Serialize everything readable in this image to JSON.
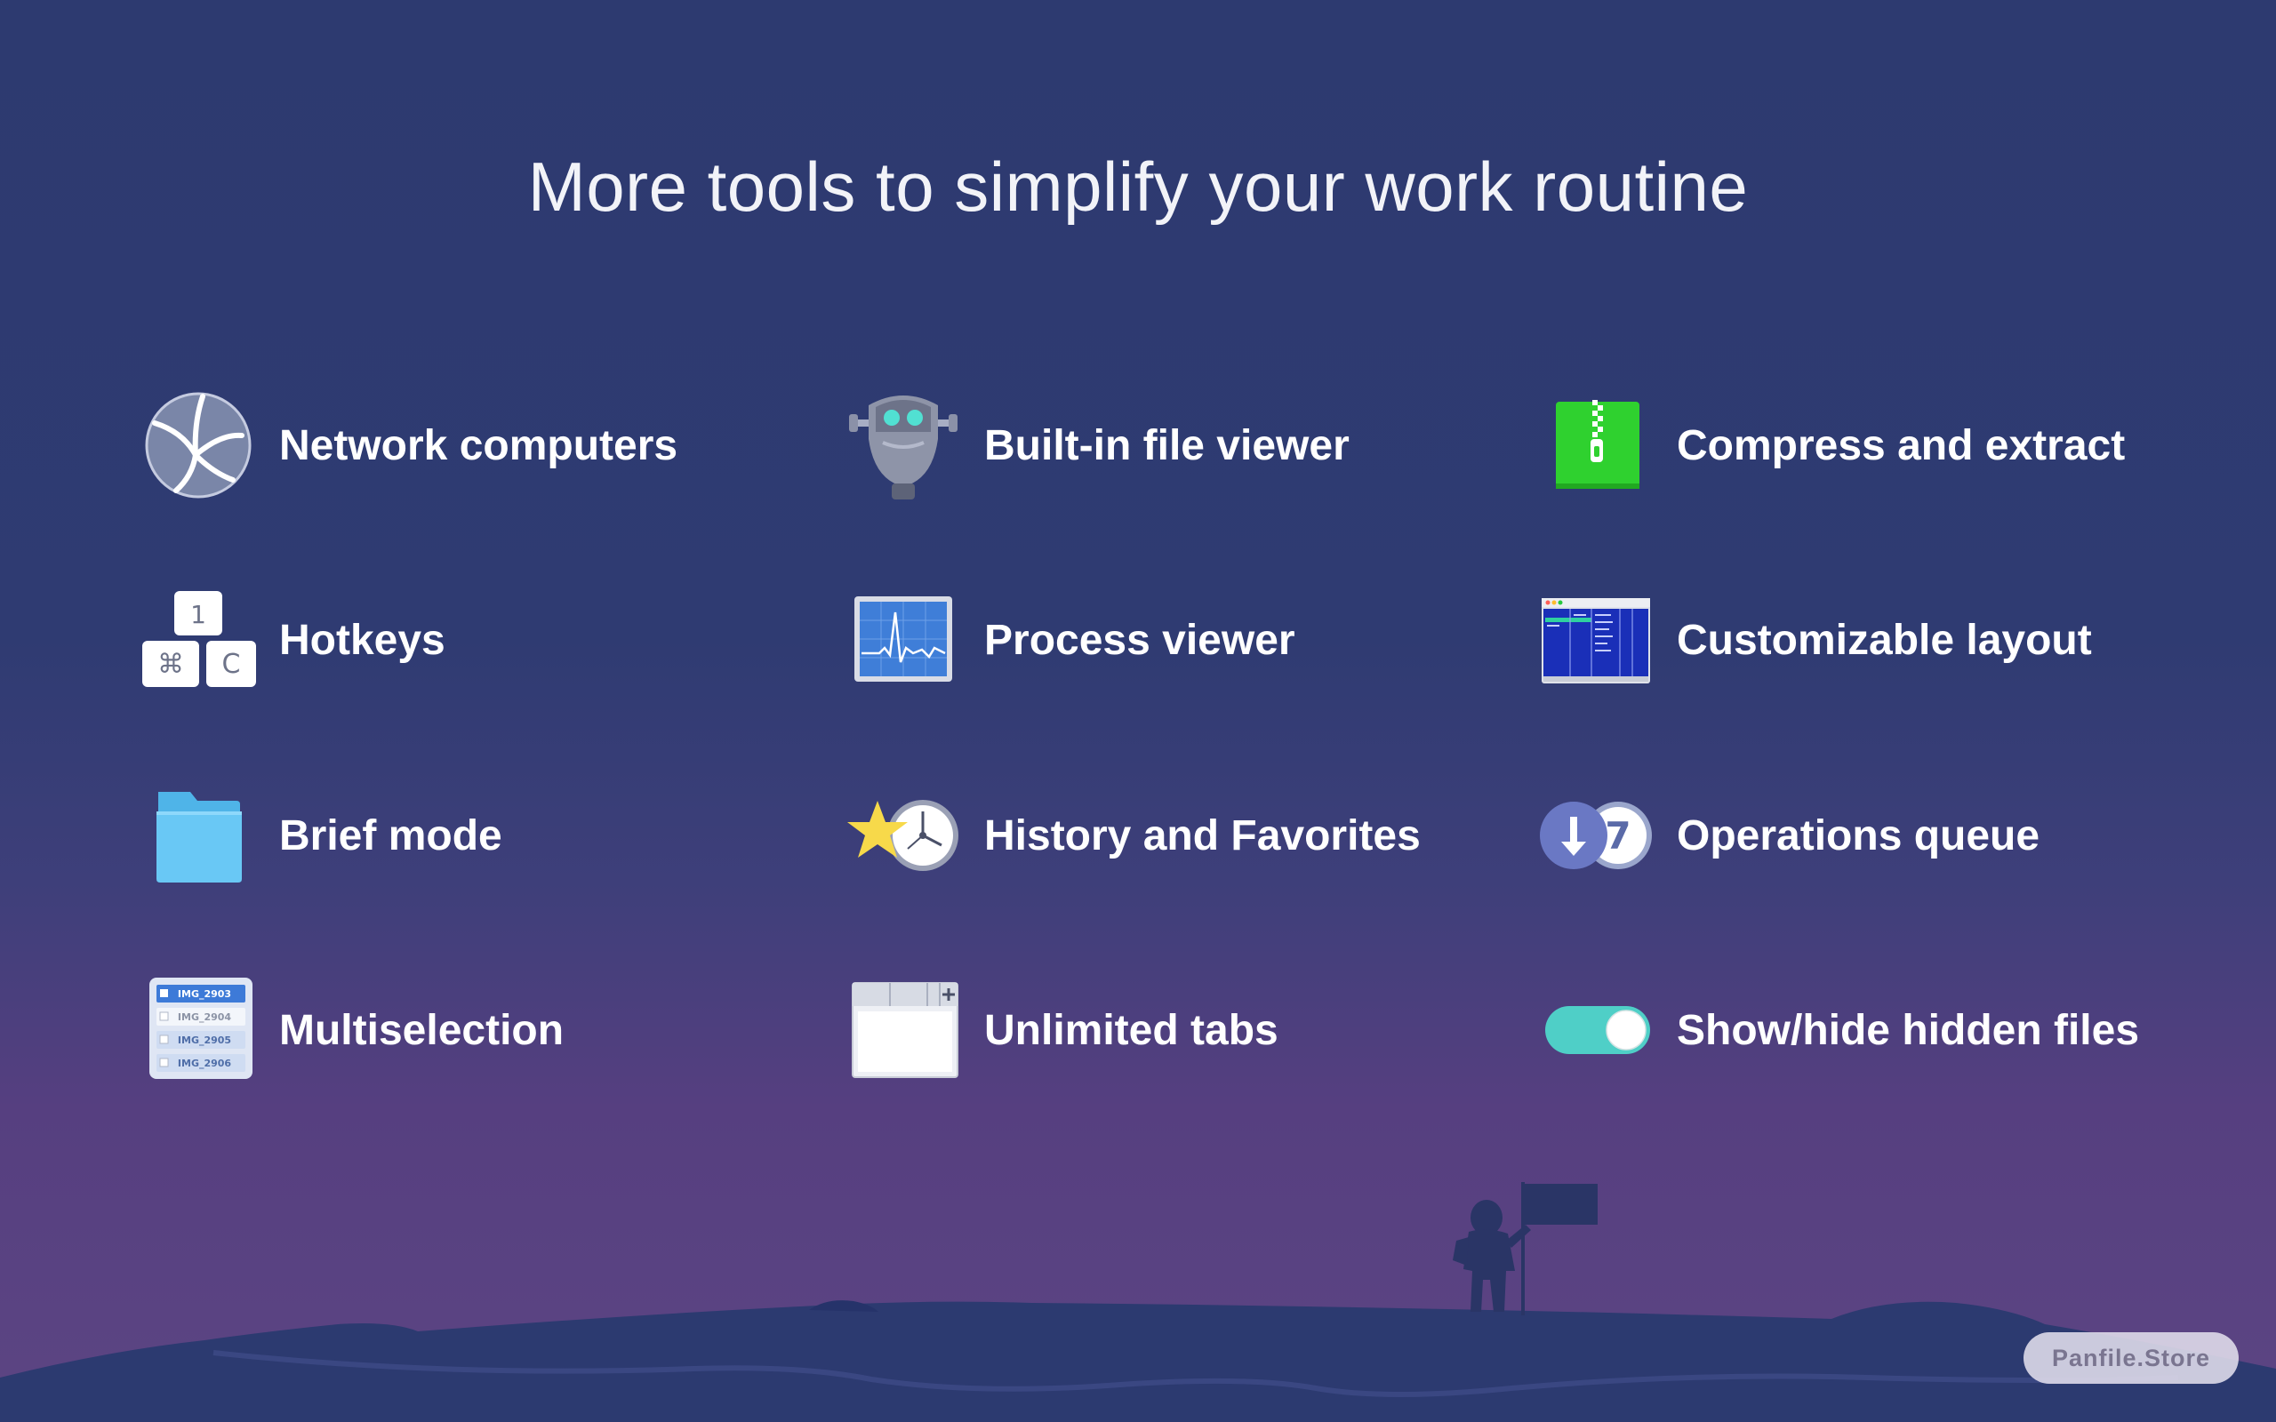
{
  "headline": "More tools to simplify your work routine",
  "features": {
    "network_computers": {
      "label": "Network computers",
      "icon": "globe-network-icon"
    },
    "file_viewer": {
      "label": "Built-in file viewer",
      "icon": "binocular-viewer-icon"
    },
    "compress": {
      "label": "Compress and extract",
      "icon": "zip-archive-icon"
    },
    "hotkeys": {
      "label": "Hotkeys",
      "icon": "keyboard-keys-icon",
      "keys": [
        "1",
        "⌘",
        "C"
      ]
    },
    "process_viewer": {
      "label": "Process viewer",
      "icon": "activity-monitor-icon"
    },
    "layout": {
      "label": "Customizable layout",
      "icon": "layout-window-icon"
    },
    "brief_mode": {
      "label": "Brief mode",
      "icon": "folder-icon"
    },
    "history": {
      "label": "History and Favorites",
      "icon": "star-clock-icon"
    },
    "queue": {
      "label": "Operations queue",
      "icon": "queue-icon",
      "count": "7"
    },
    "multiselection": {
      "label": "Multiselection",
      "icon": "file-list-icon",
      "files": [
        "IMG_2903",
        "IMG_2904",
        "IMG_2905",
        "IMG_2906"
      ]
    },
    "tabs": {
      "label": "Unlimited tabs",
      "icon": "tabs-window-icon"
    },
    "hidden_files": {
      "label": "Show/hide hidden files",
      "icon": "toggle-switch-icon"
    }
  },
  "watermark": "Panfile.Store",
  "colors": {
    "background_top": "#2d3a70",
    "background_bottom": "#5c4583",
    "toggle_accent": "#4fcfc7",
    "zip_green": "#2fd12f",
    "folder_blue": "#5cc3f2"
  }
}
